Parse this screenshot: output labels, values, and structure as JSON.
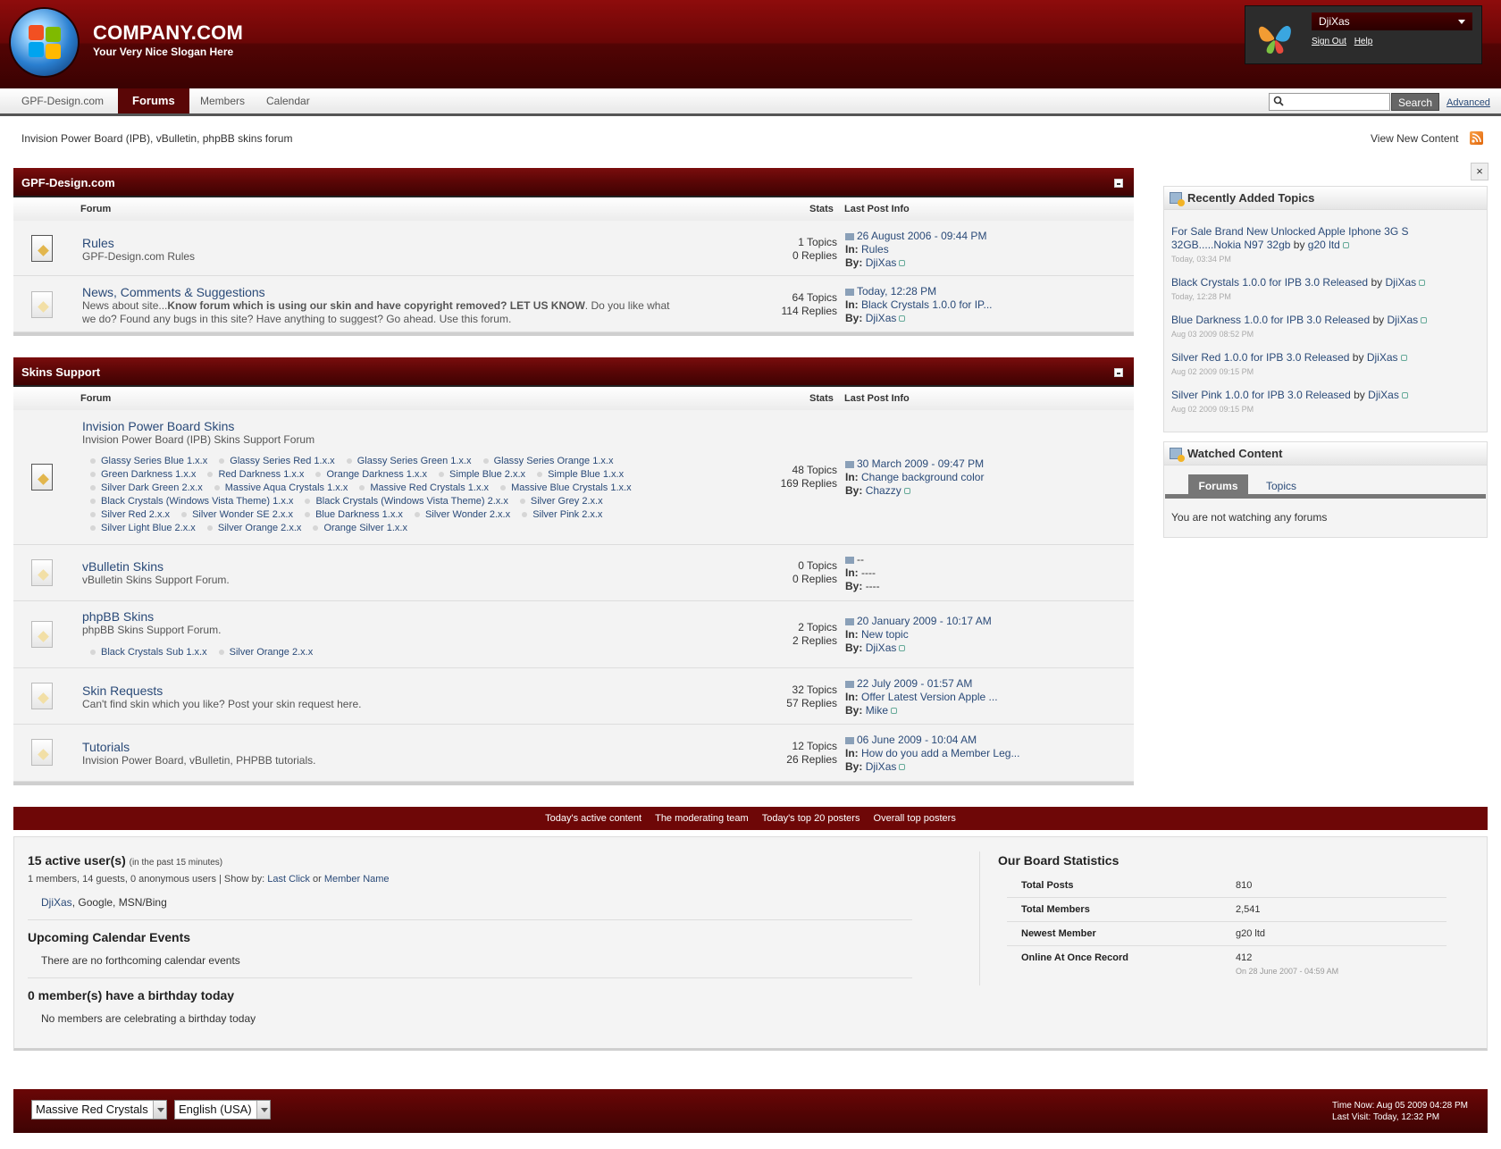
{
  "brand": {
    "name": "COMPANY.COM",
    "slogan": "Your Very Nice Slogan Here"
  },
  "user": {
    "name": "DjiXas",
    "sign_out": "Sign Out",
    "help": "Help"
  },
  "nav": {
    "tabs": [
      "GPF-Design.com",
      "Forums",
      "Members",
      "Calendar"
    ],
    "active_tab": "Forums",
    "search_placeholder": "",
    "search_button": "Search",
    "advanced": "Advanced"
  },
  "board": {
    "description": "Invision Power Board (IPB), vBulletin, phpBB skins forum",
    "view_new": "View New Content"
  },
  "colors": {
    "accent": "#5a0606",
    "link": "#2a4a78",
    "rss": "#e1660a"
  },
  "categories": [
    {
      "title": "GPF-Design.com",
      "col_forum": "Forum",
      "col_stats": "Stats",
      "col_last": "Last Post Info",
      "forums": [
        {
          "name": "Rules",
          "desc": "GPF-Design.com Rules",
          "topics": "1 Topics",
          "replies": "0 Replies",
          "last_date": "26 August 2006 - 09:44 PM",
          "in_label": "In:",
          "in": "Rules",
          "by_label": "By:",
          "by": "DjiXas"
        },
        {
          "name": "News, Comments & Suggestions",
          "desc_a": "News about site...",
          "desc_b": "Know forum which is using our skin and have copyright removed? LET US KNOW",
          "desc_c": ". Do you like what we do? Found any bugs in this site? Have anything to suggest? Go ahead. Use this forum.",
          "topics": "64 Topics",
          "replies": "114 Replies",
          "last_date": "Today, 12:28 PM",
          "in_label": "In:",
          "in": "Black Crystals 1.0.0 for IP...",
          "by_label": "By:",
          "by": "DjiXas"
        }
      ]
    },
    {
      "title": "Skins Support",
      "col_forum": "Forum",
      "col_stats": "Stats",
      "col_last": "Last Post Info",
      "forums": [
        {
          "name": "Invision Power Board Skins",
          "desc": "Invision Power Board (IPB) Skins Support Forum",
          "subforums": [
            "Glassy Series Blue 1.x.x",
            "Glassy Series Red 1.x.x",
            "Glassy Series Green 1.x.x",
            "Glassy Series Orange 1.x.x",
            "Green Darkness 1.x.x",
            "Red Darkness 1.x.x",
            "Orange Darkness 1.x.x",
            "Simple Blue 2.x.x",
            "Simple Blue 1.x.x",
            "Silver Dark Green 2.x.x",
            "Massive Aqua Crystals 1.x.x",
            "Massive Red Crystals 1.x.x",
            "Massive Blue Crystals 1.x.x",
            "Black Crystals (Windows Vista Theme) 1.x.x",
            "Black Crystals (Windows Vista Theme) 2.x.x",
            "Silver Grey 2.x.x",
            "Silver Red 2.x.x",
            "Silver Wonder SE 2.x.x",
            "Blue Darkness 1.x.x",
            "Silver Wonder 2.x.x",
            "Silver Pink 2.x.x",
            "Silver Light Blue 2.x.x",
            "Silver Orange 2.x.x",
            "Orange Silver 1.x.x"
          ],
          "topics": "48 Topics",
          "replies": "169 Replies",
          "last_date": "30 March 2009 - 09:47 PM",
          "in_label": "In:",
          "in": "Change background color",
          "by_label": "By:",
          "by": "Chazzy"
        },
        {
          "name": "vBulletin Skins",
          "desc": "vBulletin Skins Support Forum.",
          "topics": "0 Topics",
          "replies": "0 Replies",
          "last_date": "--",
          "in_label": "In:",
          "in": "----",
          "by_label": "By:",
          "by": "----"
        },
        {
          "name": "phpBB Skins",
          "desc": "phpBB Skins Support Forum.",
          "subforums": [
            "Black Crystals Sub 1.x.x",
            "Silver Orange 2.x.x"
          ],
          "topics": "2 Topics",
          "replies": "2 Replies",
          "last_date": "20 January 2009 - 10:17 AM",
          "in_label": "In:",
          "in": "New topic",
          "by_label": "By:",
          "by": "DjiXas"
        },
        {
          "name": "Skin Requests",
          "desc": "Can't find skin which you like? Post your skin request here.",
          "topics": "32 Topics",
          "replies": "57 Replies",
          "last_date": "22 July 2009 - 01:57 AM",
          "in_label": "In:",
          "in": "Offer Latest Version Apple ...",
          "by_label": "By:",
          "by": "Mike"
        },
        {
          "name": "Tutorials",
          "desc": "Invision Power Board, vBulletin, PHPBB tutorials.",
          "topics": "12 Topics",
          "replies": "26 Replies",
          "last_date": "06 June 2009 - 10:04 AM",
          "in_label": "In:",
          "in": "How do you add a Member Leg...",
          "by_label": "By:",
          "by": "DjiXas"
        }
      ]
    }
  ],
  "sidebar": {
    "close": "×",
    "recent": {
      "title": "Recently Added Topics",
      "topics": [
        {
          "title": "For Sale Brand New Unlocked Apple Iphone 3G S 32GB.....Nokia N97 32gb",
          "by": "g20 ltd",
          "date": "Today, 03:34 PM"
        },
        {
          "title": "Black Crystals 1.0.0 for IPB 3.0 Released",
          "by": "DjiXas",
          "date": "Today, 12:28 PM"
        },
        {
          "title": "Blue Darkness 1.0.0 for IPB 3.0 Released",
          "by": "DjiXas",
          "date": "Aug 03 2009 08:52 PM"
        },
        {
          "title": "Silver Red 1.0.0 for IPB 3.0 Released",
          "by": "DjiXas",
          "date": "Aug 02 2009 09:15 PM"
        },
        {
          "title": "Silver Pink 1.0.0 for IPB 3.0 Released",
          "by": "DjiXas",
          "date": "Aug 02 2009 09:15 PM"
        }
      ],
      "by_word": "by"
    },
    "watched": {
      "title": "Watched Content",
      "tab_forums": "Forums",
      "tab_topics": "Topics",
      "message": "You are not watching any forums"
    }
  },
  "stats_bar": [
    "Today's active content",
    "The moderating team",
    "Today's top 20 posters",
    "Overall top posters"
  ],
  "active": {
    "title": "15 active user(s)",
    "window": "(in the past 15 minutes)",
    "breakdown": "1 members, 14 guests, 0 anonymous users | Show by:",
    "sort_last": "Last Click",
    "sort_or": "or",
    "sort_name": "Member Name",
    "users_member": "DjiXas",
    "users_rest": ", Google, MSN/Bing"
  },
  "calendar": {
    "title": "Upcoming Calendar Events",
    "message": "There are no forthcoming calendar events"
  },
  "birthday": {
    "title": "0 member(s) have a birthday today",
    "message": "No members are celebrating a birthday today"
  },
  "board_stats": {
    "title": "Our Board Statistics",
    "rows": [
      {
        "k": "Total Posts",
        "v": "810"
      },
      {
        "k": "Total Members",
        "v": "2,541"
      },
      {
        "k": "Newest Member",
        "v": "g20 ltd"
      },
      {
        "k": "Online At Once Record",
        "v": "412",
        "sub": "On 28 June 2007 - 04:59 AM"
      }
    ]
  },
  "footer": {
    "skin": "Massive Red Crystals",
    "language": "English (USA)",
    "time_now": "Time Now: Aug 05 2009 04:28 PM",
    "last_visit": "Last Visit: Today, 12:32 PM"
  }
}
